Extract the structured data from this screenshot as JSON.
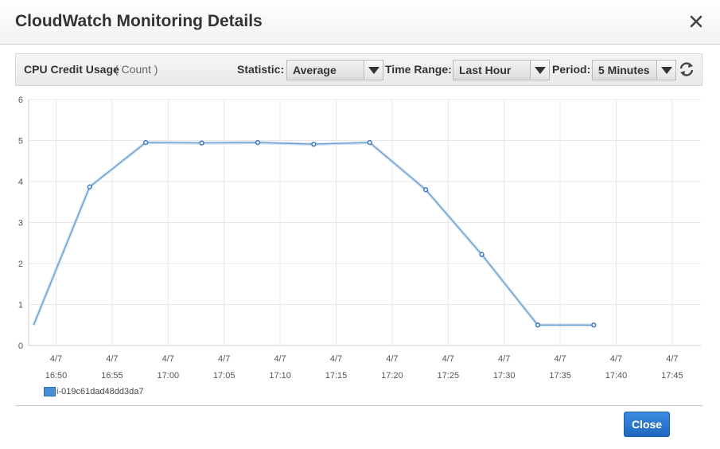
{
  "dialog": {
    "title": "CloudWatch Monitoring Details",
    "close_icon": "close-icon",
    "close_button_label": "Close"
  },
  "toolbar": {
    "metric_name": "CPU Credit Usage",
    "metric_unit": "( Count )",
    "statistic_label": "Statistic:",
    "statistic_value": "Average",
    "time_range_label": "Time Range:",
    "time_range_value": "Last Hour",
    "period_label": "Period:",
    "period_value": "5 Minutes",
    "refresh_icon": "refresh-icon",
    "dropdown_icon": "chevron-down-icon"
  },
  "colors": {
    "series_line": "#6a9fd0",
    "series_marker": "#3a78c2",
    "grid": "#e8e8e8",
    "axis_text": "#555555",
    "primary_button": "#2a77d0"
  },
  "chart_data": {
    "type": "line",
    "ylim": [
      0,
      6
    ],
    "y_ticks": [
      "0",
      "1",
      "2",
      "3",
      "4",
      "5",
      "6"
    ],
    "x_ticks": [
      {
        "date": "4/7",
        "time": "16:50"
      },
      {
        "date": "4/7",
        "time": "16:55"
      },
      {
        "date": "4/7",
        "time": "17:00"
      },
      {
        "date": "4/7",
        "time": "17:05"
      },
      {
        "date": "4/7",
        "time": "17:10"
      },
      {
        "date": "4/7",
        "time": "17:15"
      },
      {
        "date": "4/7",
        "time": "17:20"
      },
      {
        "date": "4/7",
        "time": "17:25"
      },
      {
        "date": "4/7",
        "time": "17:30"
      },
      {
        "date": "4/7",
        "time": "17:35"
      },
      {
        "date": "4/7",
        "time": "17:40"
      },
      {
        "date": "4/7",
        "time": "17:45"
      }
    ],
    "grid": true,
    "legend_position": "bottom-left",
    "series": [
      {
        "name": "i-019c61dad48dd3da7",
        "points": [
          {
            "x": "16:48",
            "y": 0.5
          },
          {
            "x": "16:53",
            "y": 3.87
          },
          {
            "x": "16:58",
            "y": 4.95
          },
          {
            "x": "17:03",
            "y": 4.94
          },
          {
            "x": "17:08",
            "y": 4.95
          },
          {
            "x": "17:13",
            "y": 4.91
          },
          {
            "x": "17:18",
            "y": 4.95
          },
          {
            "x": "17:23",
            "y": 3.8
          },
          {
            "x": "17:28",
            "y": 2.22
          },
          {
            "x": "17:33",
            "y": 0.5
          },
          {
            "x": "17:38",
            "y": 0.5
          }
        ]
      }
    ]
  }
}
